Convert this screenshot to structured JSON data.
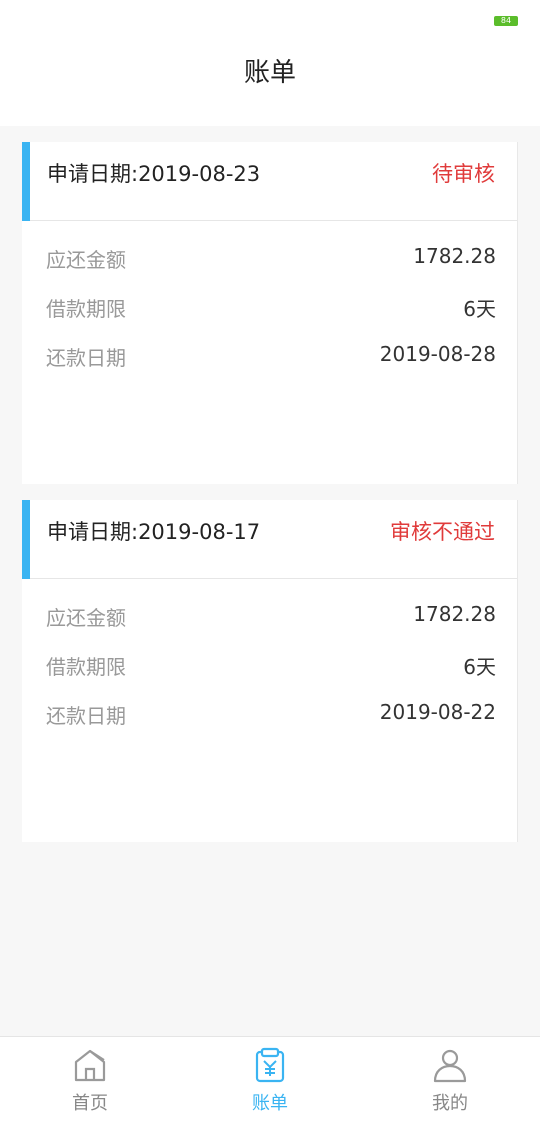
{
  "status_bar": {
    "battery_level": "84"
  },
  "header": {
    "title": "账单"
  },
  "bills": [
    {
      "apply_date": "申请日期:2019-08-23",
      "status": "待审核",
      "rows": [
        {
          "label": "应还金额",
          "value": "1782.28"
        },
        {
          "label": "借款期限",
          "value": "6天"
        },
        {
          "label": "还款日期",
          "value": "2019-08-28"
        }
      ]
    },
    {
      "apply_date": "申请日期:2019-08-17",
      "status": "审核不通过",
      "rows": [
        {
          "label": "应还金额",
          "value": "1782.28"
        },
        {
          "label": "借款期限",
          "value": "6天"
        },
        {
          "label": "还款日期",
          "value": "2019-08-22"
        }
      ]
    }
  ],
  "tab_bar": {
    "tabs": [
      {
        "label": "首页",
        "icon": "home-icon",
        "active": false
      },
      {
        "label": "账单",
        "icon": "bill-icon",
        "active": true
      },
      {
        "label": "我的",
        "icon": "user-icon",
        "active": false
      }
    ]
  },
  "colors": {
    "accent": "#3ab4f2",
    "status_red": "#e03b3b",
    "battery_green": "#5bbd2b"
  }
}
